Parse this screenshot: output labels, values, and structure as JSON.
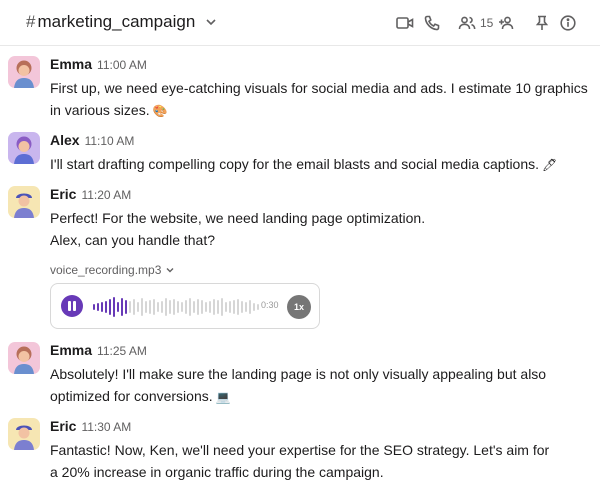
{
  "channel": {
    "hash": "#",
    "name": "marketing_campaign"
  },
  "header_icons": {
    "video": "video-camera-icon",
    "phone": "phone-icon",
    "members": "people-icon",
    "member_count": "15",
    "add_member": "add-person-icon",
    "pin": "pin-icon",
    "info": "info-icon"
  },
  "messages": [
    {
      "author": "Emma",
      "time": "11:00 AM",
      "avatar_color": "#f3c6d9",
      "lines": [
        "First up, we need eye-catching visuals for social media and ads. I estimate 10 graphics",
        "in various sizes."
      ],
      "emoji": "🎨"
    },
    {
      "author": "Alex",
      "time": "11:10 AM",
      "avatar_color": "#c9b6ee",
      "lines": [
        "I'll start drafting compelling copy for the email blasts and social media captions."
      ],
      "emoji": "🖊"
    },
    {
      "author": "Eric",
      "time": "11:20 AM",
      "avatar_color": "#f6e6b3",
      "lines": [
        "Perfect! For the website, we need landing page optimization.",
        "Alex, can you handle that?"
      ],
      "attachment": {
        "file_name": "voice_recording.mp3",
        "duration": "0:30",
        "speed": "1x"
      }
    },
    {
      "author": "Emma",
      "time": "11:25 AM",
      "avatar_color": "#f3c6d9",
      "lines": [
        "Absolutely! I'll make sure the landing page is not only visually appealing but also",
        "optimized for conversions."
      ],
      "emoji": "💻"
    },
    {
      "author": "Eric",
      "time": "11:30 AM",
      "avatar_color": "#f6e6b3",
      "lines": [
        "Fantastic! Now, Ken, we'll need your expertise for the SEO strategy. Let's aim for",
        "a 20% increase in organic traffic during the campaign."
      ]
    }
  ],
  "colors": {
    "accent": "#6739b7",
    "waveform_played": "#6739b7",
    "waveform_unplayed": "#d6d6d6"
  }
}
